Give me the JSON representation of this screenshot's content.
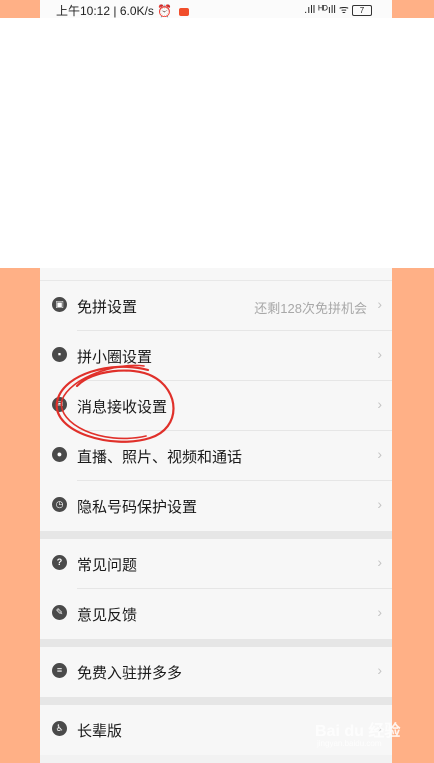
{
  "status_bar": {
    "time": "上午10:12",
    "speed": "6.0K/s",
    "signal": ".ıll ᴴᴰıll",
    "wifi": "ᯤ",
    "battery": "7"
  },
  "settings": {
    "group1": [
      {
        "label": "免拼设置",
        "value": "还剩128次免拼机会",
        "icon": "free-group-icon"
      },
      {
        "label": "拼小圈设置",
        "value": "",
        "icon": "lock-icon"
      },
      {
        "label": "消息接收设置",
        "value": "",
        "icon": "message-icon"
      },
      {
        "label": "直播、照片、视频和通话",
        "value": "",
        "icon": "camera-icon"
      },
      {
        "label": "隐私号码保护设置",
        "value": "",
        "icon": "privacy-icon"
      }
    ],
    "group2": [
      {
        "label": "常见问题",
        "value": "",
        "icon": "question-icon"
      },
      {
        "label": "意见反馈",
        "value": "",
        "icon": "feedback-icon"
      }
    ],
    "group3": [
      {
        "label": "免费入驻拼多多",
        "value": "",
        "icon": "store-icon"
      }
    ],
    "group4": [
      {
        "label": "长辈版",
        "value": "",
        "icon": "elder-icon"
      }
    ]
  },
  "watermark": {
    "logo_text": "Bai du 经验",
    "sub_text": "jingyan.baidu.com"
  },
  "colors": {
    "side_fill": "#ffb086",
    "annotation": "#e0302a"
  }
}
